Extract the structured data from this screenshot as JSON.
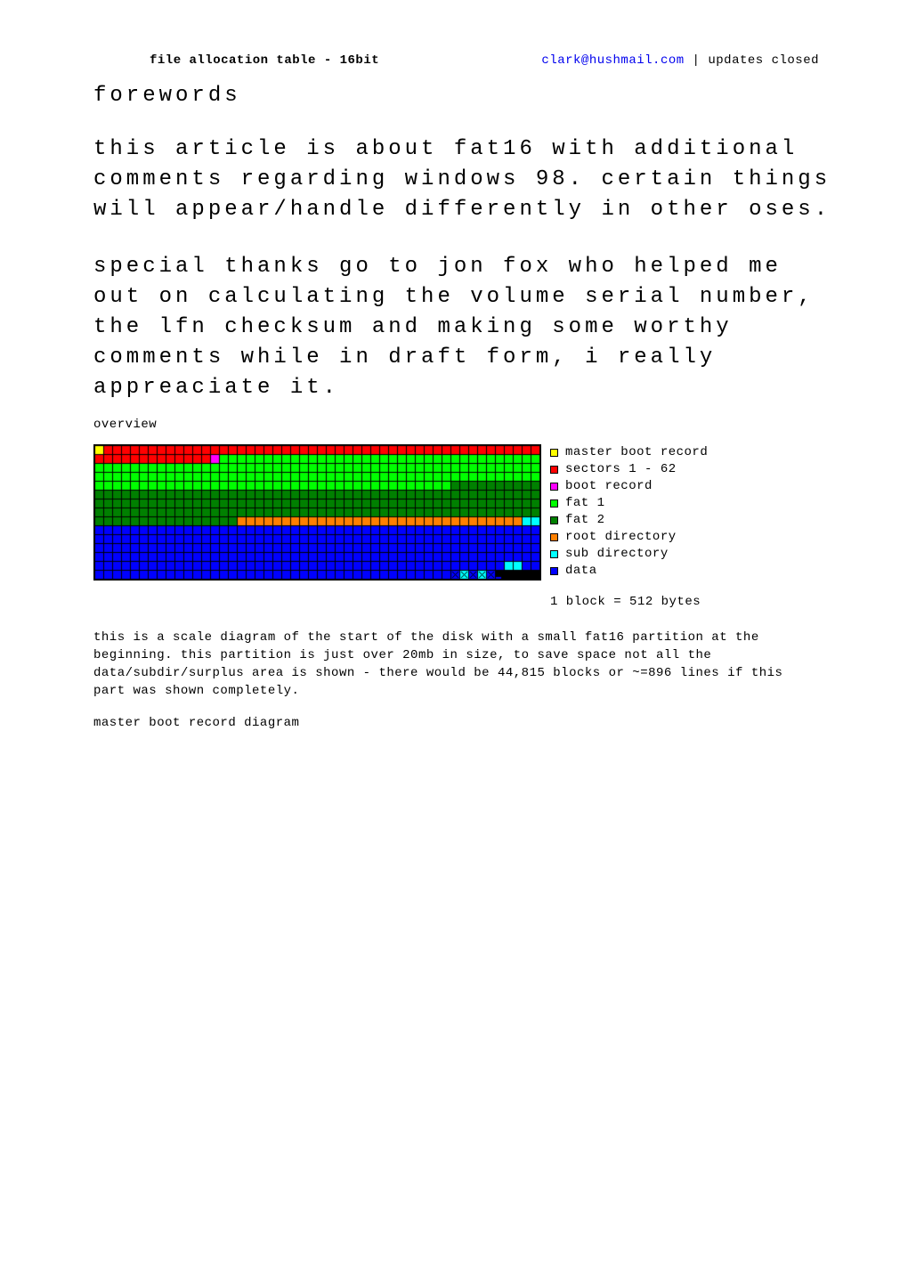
{
  "header": {
    "title": "file allocation table - 16bit",
    "email": "clark@hushmail.com",
    "sep": " | ",
    "updates": "updates closed"
  },
  "sections": {
    "forewords_heading": "forewords",
    "forewords_p1": "this article is about fat16 with additional comments regarding windows 98. certain things will appear/handle differently in other oses.",
    "forewords_p2": "special thanks go to jon fox who helped me out on calculating the volume serial number, the lfn checksum and making some worthy comments while in draft form, i really appreaciate it.",
    "overview_heading": "overview",
    "overview_caption": "this is a scale diagram of the start of the disk with a small fat16 partition at the beginning. this partition is just over 20mb in size, to save space not all the data/subdir/surplus area is shown - there would be 44,815 blocks or ~=896 lines if this part was shown completely.",
    "mbr_heading": "master boot record diagram"
  },
  "legend": {
    "items": [
      {
        "color": "#ffff00",
        "label": "master boot record"
      },
      {
        "color": "#ff0000",
        "label": "sectors 1 - 62"
      },
      {
        "color": "#ff00ff",
        "label": "boot record"
      },
      {
        "color": "#00ff00",
        "label": "fat 1"
      },
      {
        "color": "#008000",
        "label": "fat 2"
      },
      {
        "color": "#ff8000",
        "label": "root directory"
      },
      {
        "color": "#00ffff",
        "label": "sub directory"
      },
      {
        "color": "#0000ff",
        "label": "data"
      }
    ],
    "note": "1 block = 512 bytes"
  },
  "diagram": {
    "cols": 50,
    "cell": 9,
    "gap": 1,
    "pad": 2,
    "segments": [
      {
        "count": 1,
        "color": "#ffff00"
      },
      {
        "count": 62,
        "color": "#ff0000"
      },
      {
        "count": 1,
        "color": "#ff00ff"
      },
      {
        "count": 176,
        "color": "#00ff00"
      },
      {
        "count": 176,
        "color": "#008000"
      },
      {
        "count": 32,
        "color": "#ff8000"
      },
      {
        "count": 2,
        "color": "#00ffff"
      },
      {
        "count": 246,
        "color": "#0000ff"
      },
      {
        "count": 2,
        "color": "#00ffff"
      },
      {
        "count": 42,
        "color": "#0000ff"
      },
      {
        "count": 1,
        "color": "#0000ff",
        "cross": true
      },
      {
        "count": 1,
        "color": "#00ffff",
        "cross": true
      },
      {
        "count": 1,
        "color": "#0000ff",
        "cross": true
      },
      {
        "count": 1,
        "color": "#00ffff",
        "cross": true
      },
      {
        "count": 1,
        "color": "#0000ff",
        "cross": true
      },
      {
        "count": 1,
        "color": "#0000ff",
        "partial": true
      }
    ]
  }
}
